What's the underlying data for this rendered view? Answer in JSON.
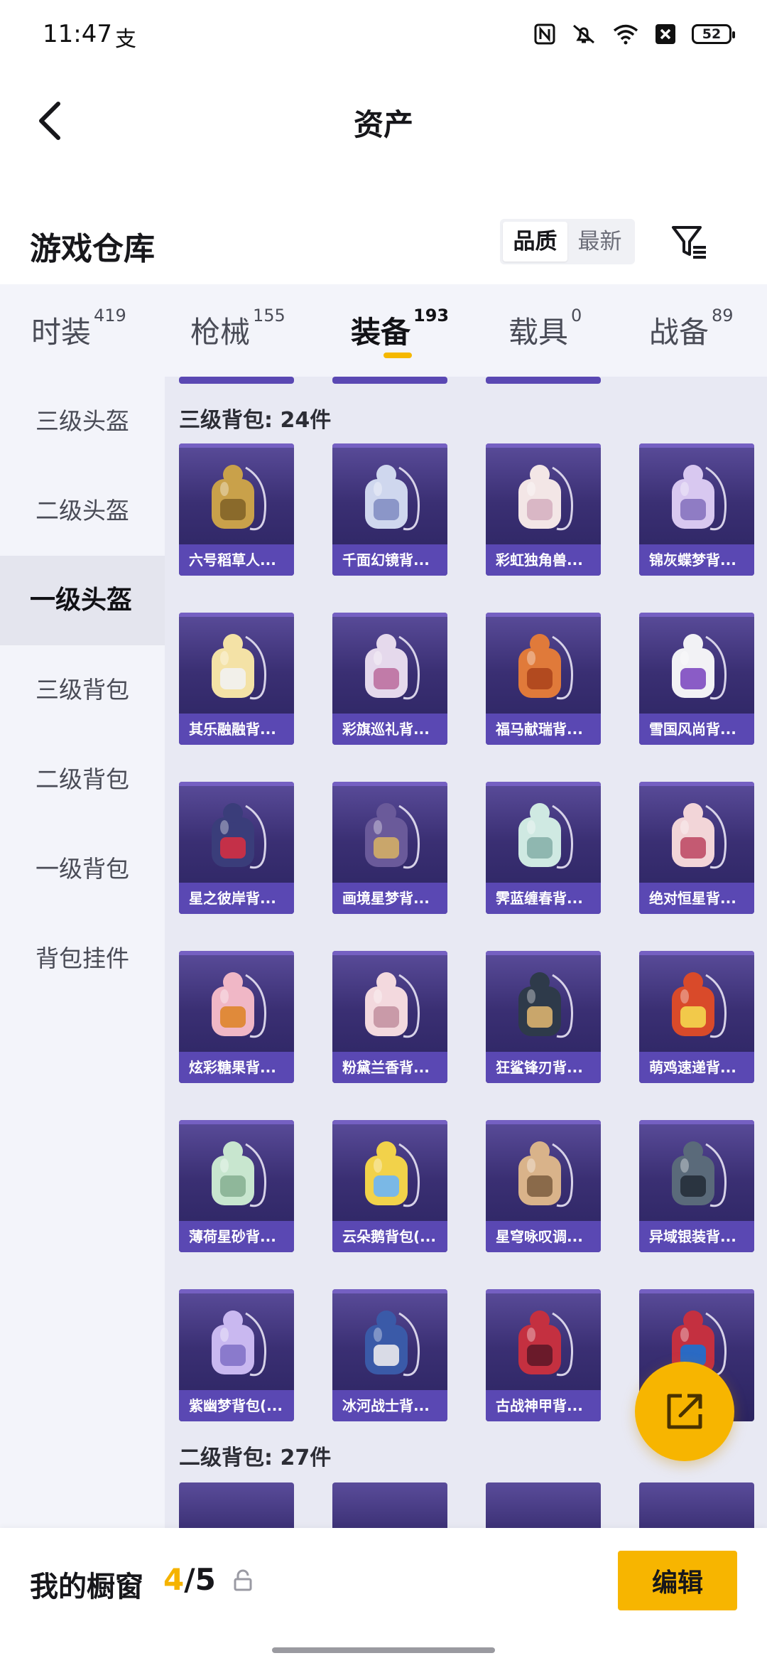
{
  "status_bar": {
    "time": "11:47",
    "extra_icon_text": "支",
    "battery": "52",
    "icons": [
      "nfc-icon",
      "mute-icon",
      "wifi-icon",
      "close-box-icon",
      "battery-icon"
    ]
  },
  "header": {
    "title": "资产",
    "back_icon": "chevron-left-icon"
  },
  "section": {
    "title": "游戏仓库",
    "sort_options": [
      "品质",
      "最新"
    ],
    "sort_selected": "品质",
    "filter_icon": "filter-icon"
  },
  "tabs": [
    {
      "label": "时装",
      "count": "419",
      "active": false
    },
    {
      "label": "枪械",
      "count": "155",
      "active": false
    },
    {
      "label": "装备",
      "count": "193",
      "active": true
    },
    {
      "label": "载具",
      "count": "0",
      "active": false
    },
    {
      "label": "战备",
      "count": "89",
      "active": false
    }
  ],
  "side_menu": [
    {
      "label": "三级头盔",
      "active": false
    },
    {
      "label": "二级头盔",
      "active": false
    },
    {
      "label": "一级头盔",
      "active": true
    },
    {
      "label": "三级背包",
      "active": false
    },
    {
      "label": "二级背包",
      "active": false
    },
    {
      "label": "一级背包",
      "active": false
    },
    {
      "label": "背包挂件",
      "active": false
    }
  ],
  "groups": [
    {
      "label": "三级背包: 24件",
      "items": [
        "六号稻草人...",
        "千面幻镜背...",
        "彩虹独角兽...",
        "锦灰蝶梦背...",
        "其乐融融背...",
        "彩旗巡礼背...",
        "福马献瑞背...",
        "雪国风尚背...",
        "星之彼岸背...",
        "画境星梦背...",
        "霁蓝缠春背...",
        "绝对恒星背...",
        "炫彩糖果背...",
        "粉黛兰香背...",
        "狂鲨锋刃背...",
        "萌鸡速递背...",
        "薄荷星砂背...",
        "云朵鹅背包(...",
        "星穹咏叹调...",
        "异域银装背...",
        "紫幽梦背包(...",
        "冰河战士背...",
        "古战神甲背...",
        ""
      ]
    },
    {
      "label": "二级背包: 27件",
      "items": []
    }
  ],
  "bottom_bar": {
    "showcase_label": "我的橱窗",
    "showcase_count": "4",
    "showcase_sep": "/",
    "showcase_max": "5",
    "edit_label": "编辑"
  },
  "colors": {
    "accent": "#f7b500",
    "card_bg": "#3a2f73",
    "card_label_bg": "#5a48b3",
    "content_bg": "#e8e9f3",
    "side_bg": "#f3f4fa"
  }
}
